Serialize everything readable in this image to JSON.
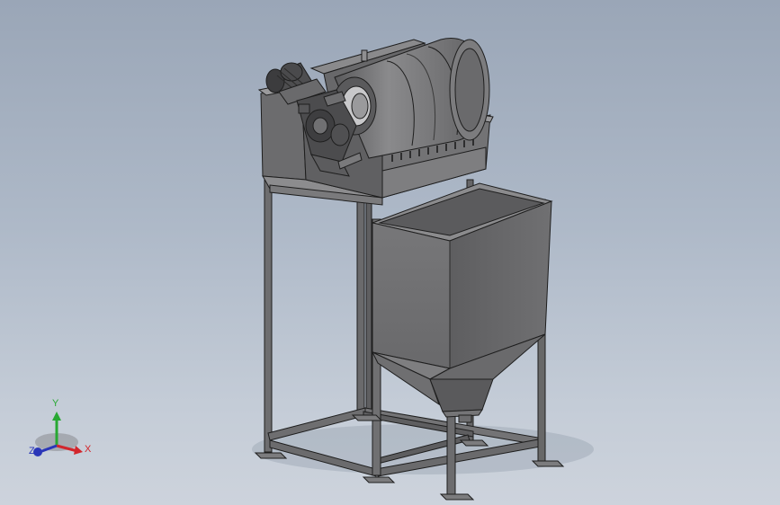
{
  "view": {
    "background_top": "#9aa6b7",
    "background_bottom": "#cdd3dc",
    "part_color": "#6f6f71",
    "edge_color": "#1e1e1e"
  },
  "model": {
    "components": [
      "motor-icon",
      "gearbox-icon",
      "rotary-drum-icon",
      "drum-housing-icon",
      "support-frame-icon",
      "collection-hopper-icon",
      "hopper-cone-icon",
      "frame-foot-icon"
    ]
  },
  "triad": {
    "x_label": "X",
    "y_label": "Y",
    "z_label": "Z",
    "x_color": "#d2262c",
    "y_color": "#28a833",
    "z_color": "#2a36b8"
  }
}
